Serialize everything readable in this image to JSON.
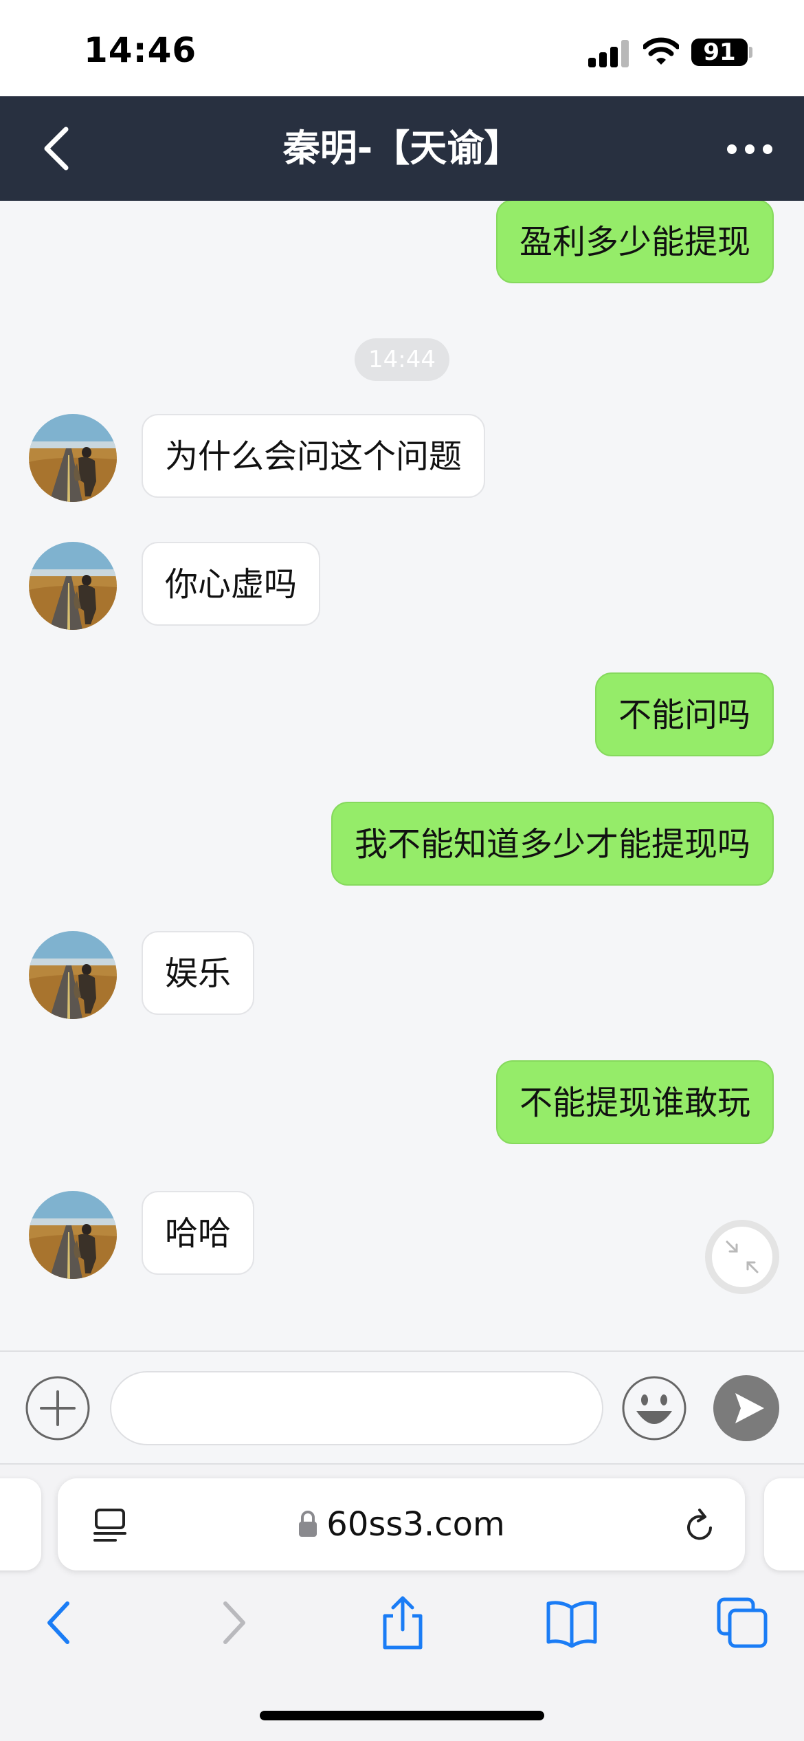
{
  "status_bar": {
    "time": "14:46",
    "battery": "91"
  },
  "nav": {
    "title": "秦明-【天谕】",
    "back_icon": "chevron-left-icon",
    "more_icon": "ellipsis-icon"
  },
  "chat": {
    "timestamp": "14:44",
    "messages": [
      {
        "side": "out",
        "text": "盈利多少能提现"
      },
      {
        "side": "in",
        "text": "为什么会问这个问题"
      },
      {
        "side": "in",
        "text": "你心虚吗"
      },
      {
        "side": "out",
        "text": "不能问吗"
      },
      {
        "side": "out",
        "text": "我不能知道多少才能提现吗"
      },
      {
        "side": "in",
        "text": "娱乐"
      },
      {
        "side": "out",
        "text": "不能提现谁敢玩"
      },
      {
        "side": "in",
        "text": "哈哈"
      }
    ]
  },
  "input_bar": {
    "value": "",
    "placeholder": "",
    "icons": [
      "plus-icon",
      "emoji-icon",
      "send-icon"
    ]
  },
  "browser": {
    "url": "60ss3.com",
    "icons": [
      "reader-icon",
      "lock-icon",
      "reload-icon"
    ],
    "toolbar": [
      "back-icon",
      "forward-icon",
      "share-icon",
      "bookmarks-icon",
      "tabs-icon"
    ]
  },
  "colors": {
    "nav_background": "#283040",
    "outgoing_bubble": "#95ec69",
    "incoming_bubble": "#ffffff",
    "browser_accent": "#1a7cf5"
  }
}
